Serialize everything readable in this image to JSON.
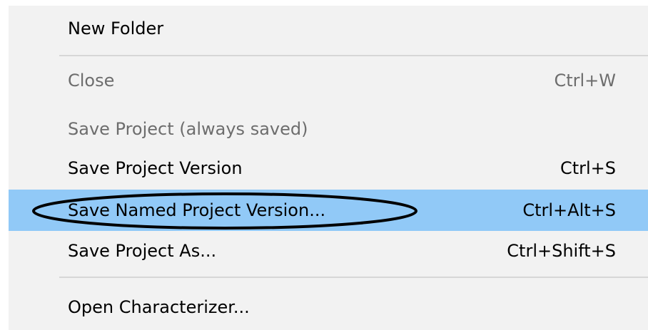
{
  "menu": {
    "items": [
      {
        "label": "New Folder",
        "shortcut": ""
      },
      {
        "label": "Close",
        "shortcut": "Ctrl+W"
      },
      {
        "label": "Save Project (always saved)",
        "shortcut": ""
      },
      {
        "label": "Save Project Version",
        "shortcut": "Ctrl+S"
      },
      {
        "label": "Save Named Project Version...",
        "shortcut": "Ctrl+Alt+S"
      },
      {
        "label": "Save Project As...",
        "shortcut": "Ctrl+Shift+S"
      },
      {
        "label": "Open Characterizer...",
        "shortcut": ""
      }
    ]
  },
  "colors": {
    "highlight": "#91c9f7",
    "disabled_text": "#6d6d6d",
    "menu_background": "#f2f2f2",
    "annotation_stroke": "#000000"
  }
}
